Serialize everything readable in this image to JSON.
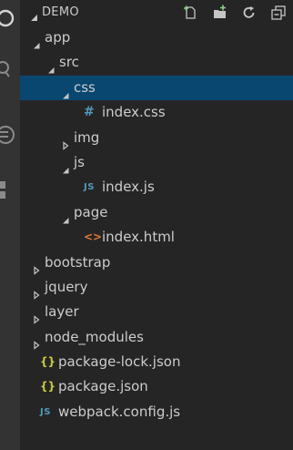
{
  "explorer": {
    "root_label": "DEMO",
    "actions": [
      {
        "name": "new-file-icon"
      },
      {
        "name": "new-folder-icon"
      },
      {
        "name": "refresh-icon"
      },
      {
        "name": "collapse-all-icon"
      }
    ]
  },
  "tree": [
    {
      "label": "app",
      "kind": "folder",
      "expanded": true,
      "depth": 1
    },
    {
      "label": "src",
      "kind": "folder",
      "expanded": true,
      "depth": 2
    },
    {
      "label": "css",
      "kind": "folder",
      "expanded": true,
      "depth": 3,
      "selected": true
    },
    {
      "label": "index.css",
      "kind": "css",
      "icon": "#",
      "depth": 4
    },
    {
      "label": "img",
      "kind": "folder",
      "expanded": false,
      "depth": 3
    },
    {
      "label": "js",
      "kind": "folder",
      "expanded": true,
      "depth": 3
    },
    {
      "label": "index.js",
      "kind": "js",
      "icon": "JS",
      "depth": 4
    },
    {
      "label": "page",
      "kind": "folder",
      "expanded": true,
      "depth": 3
    },
    {
      "label": "index.html",
      "kind": "html",
      "icon": "<>",
      "depth": 4
    },
    {
      "label": "bootstrap",
      "kind": "folder",
      "expanded": false,
      "depth": 1
    },
    {
      "label": "jquery",
      "kind": "folder",
      "expanded": false,
      "depth": 1
    },
    {
      "label": "layer",
      "kind": "folder",
      "expanded": false,
      "depth": 1
    },
    {
      "label": "node_modules",
      "kind": "folder",
      "expanded": false,
      "depth": 1
    },
    {
      "label": "package-lock.json",
      "kind": "json",
      "icon": "{}",
      "depth": 1
    },
    {
      "label": "package.json",
      "kind": "json",
      "icon": "{}",
      "depth": 1
    },
    {
      "label": "webpack.config.js",
      "kind": "js",
      "icon": "JS",
      "depth": 1
    }
  ],
  "colors": {
    "background": "#252526",
    "activity_bar": "#333333",
    "selection": "#094771",
    "text": "#cccccc",
    "css_icon": "#519aba",
    "js_icon": "#519aba",
    "html_icon": "#e37933",
    "json_icon": "#cbcb41"
  }
}
